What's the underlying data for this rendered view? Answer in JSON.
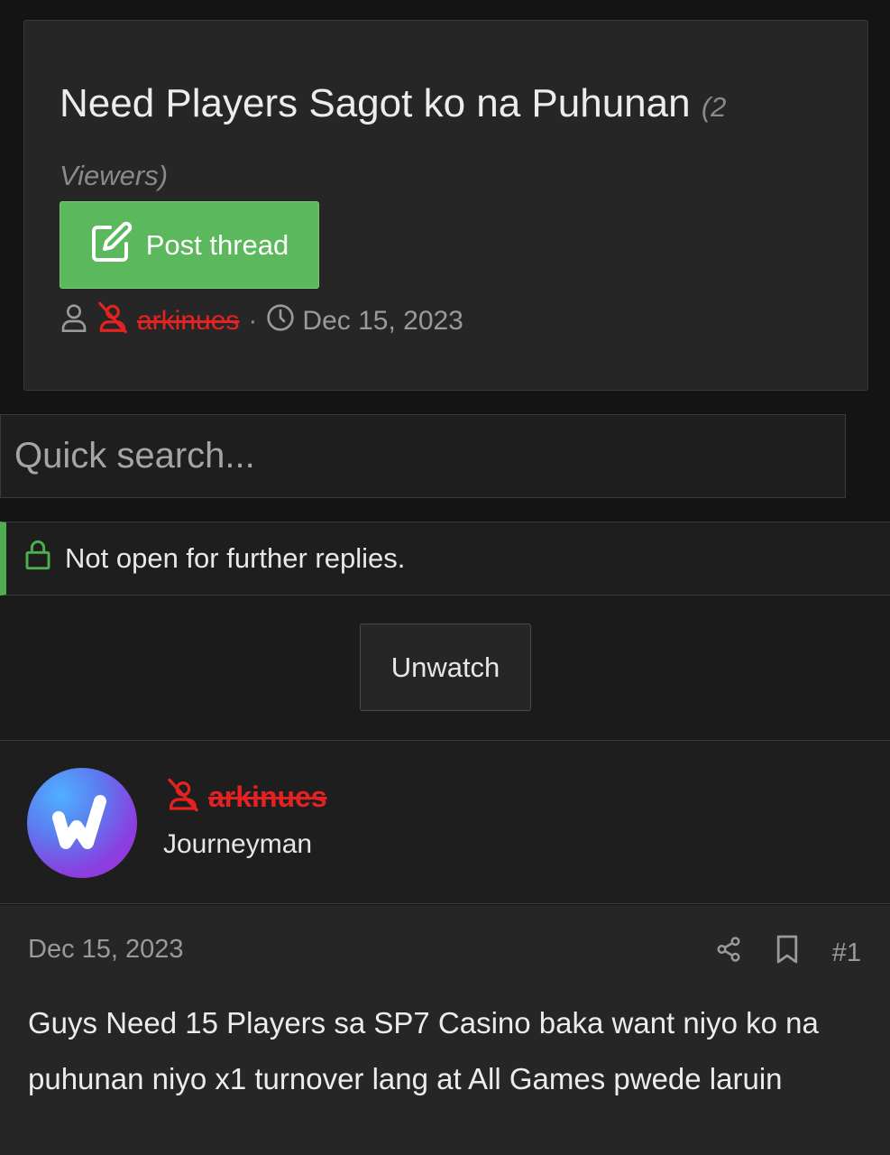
{
  "thread": {
    "title": "Need Players Sagot ko na Puhunan",
    "viewers": "(2 Viewers)",
    "post_thread_label": "Post thread",
    "author": "arkinues",
    "separator": "·",
    "date": "Dec 15, 2023"
  },
  "search": {
    "placeholder": "Quick search..."
  },
  "notice": {
    "text": "Not open for further replies."
  },
  "watch": {
    "label": "Unwatch"
  },
  "post": {
    "username": "arkinues",
    "user_title": "Journeyman",
    "date": "Dec 15, 2023",
    "number": "#1",
    "text": "Guys Need 15 Players sa SP7 Casino baka want niyo ko na puhunan niyo x1 turnover lang at All Games pwede laruin"
  },
  "colors": {
    "accent_green": "#5cb85c",
    "banned_red": "#e52222"
  }
}
